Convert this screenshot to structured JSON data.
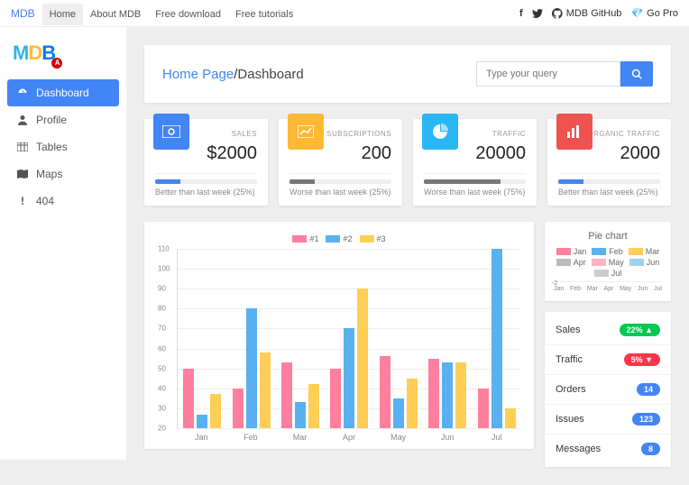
{
  "topnav": {
    "brand": "MDB",
    "items": [
      "Home",
      "About MDB",
      "Free download",
      "Free tutorials"
    ],
    "active_index": 0,
    "github": "MDB GitHub",
    "gopro": "Go Pro"
  },
  "sidebar": {
    "items": [
      {
        "icon": "gauge",
        "label": "Dashboard"
      },
      {
        "icon": "user",
        "label": "Profile"
      },
      {
        "icon": "table",
        "label": "Tables"
      },
      {
        "icon": "map",
        "label": "Maps"
      },
      {
        "icon": "excl",
        "label": "404"
      }
    ],
    "active_index": 0
  },
  "breadcrumb": {
    "home": "Home Page",
    "sep": "/",
    "current": "Dashboard"
  },
  "search": {
    "placeholder": "Type your query"
  },
  "stats": [
    {
      "color": "blue",
      "icon": "money",
      "label": "SALES",
      "value": "$2000",
      "progress": 25,
      "bar": "pb-blue",
      "note": "Better than last week (25%)"
    },
    {
      "color": "orange",
      "icon": "chart",
      "label": "SUBSCRIPTIONS",
      "value": "200",
      "progress": 25,
      "bar": "pb-grey",
      "note": "Worse than last week (25%)"
    },
    {
      "color": "cyan",
      "icon": "pie",
      "label": "TRAFFIC",
      "value": "20000",
      "progress": 75,
      "bar": "pb-grey",
      "note": "Worse than last week (75%)"
    },
    {
      "color": "red",
      "icon": "bars",
      "label": "ORGANIC TRAFFIC",
      "value": "2000",
      "progress": 25,
      "bar": "pb-blue",
      "note": "Better than last week (25%)"
    }
  ],
  "chart_data": {
    "type": "bar",
    "categories": [
      "Jan",
      "Feb",
      "Mar",
      "Apr",
      "May",
      "Jun",
      "Jul"
    ],
    "series": [
      {
        "name": "#1",
        "color": "#ff7f9e",
        "values": [
          50,
          40,
          53,
          50,
          56,
          55,
          40
        ]
      },
      {
        "name": "#2",
        "color": "#5ab1ef",
        "values": [
          27,
          80,
          33,
          70,
          35,
          53,
          110
        ]
      },
      {
        "name": "#3",
        "color": "#ffce56",
        "values": [
          37,
          58,
          42,
          90,
          45,
          53,
          30
        ]
      }
    ],
    "ylim": [
      20,
      110
    ],
    "yticks": [
      20,
      30,
      40,
      50,
      60,
      70,
      80,
      90,
      100,
      110
    ]
  },
  "pie": {
    "title": "Pie chart",
    "legend": [
      {
        "label": "Jan",
        "color": "#ff7f9e"
      },
      {
        "label": "Feb",
        "color": "#5ab1ef"
      },
      {
        "label": "Mar",
        "color": "#ffce56"
      },
      {
        "label": "Apr",
        "color": "#bbb"
      },
      {
        "label": "May",
        "color": "#ffb3c0"
      },
      {
        "label": "Jun",
        "color": "#9ed3f0"
      },
      {
        "label": "Jul",
        "color": "#ccc"
      }
    ],
    "neg": "-2",
    "months": [
      "Jan",
      "Feb",
      "Mar",
      "Apr",
      "May",
      "Jun",
      "Jul"
    ]
  },
  "list": [
    {
      "label": "Sales",
      "badge": "22% ▲",
      "badge_class": "badge-green"
    },
    {
      "label": "Traffic",
      "badge": "5% ▼",
      "badge_class": "badge-red"
    },
    {
      "label": "Orders",
      "badge": "14",
      "badge_class": "badge-blue"
    },
    {
      "label": "Issues",
      "badge": "123",
      "badge_class": "badge-blue"
    },
    {
      "label": "Messages",
      "badge": "8",
      "badge_class": "badge-blue"
    }
  ]
}
